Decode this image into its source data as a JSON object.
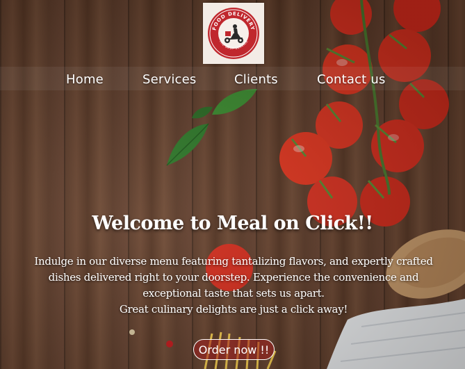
{
  "logo": {
    "top_text": "FOOD DELIVERY",
    "bottom_text": "THE BEST SERVICE",
    "icon": "scooter-courier-icon",
    "accent_color": "#c0272d"
  },
  "nav": {
    "items": [
      {
        "label": "Home"
      },
      {
        "label": "Services"
      },
      {
        "label": "Clients"
      },
      {
        "label": "Contact us"
      }
    ]
  },
  "hero": {
    "title": "Welcome to Meal on Click!!",
    "description": "Indulge in our diverse menu featuring tantalizing flavors, and expertly crafted dishes delivered right to your doorstep. Experience the convenience and exceptional taste that sets us apart.",
    "tagline": "Great culinary delights are just a click away!",
    "cta_label": "Order now !!"
  }
}
